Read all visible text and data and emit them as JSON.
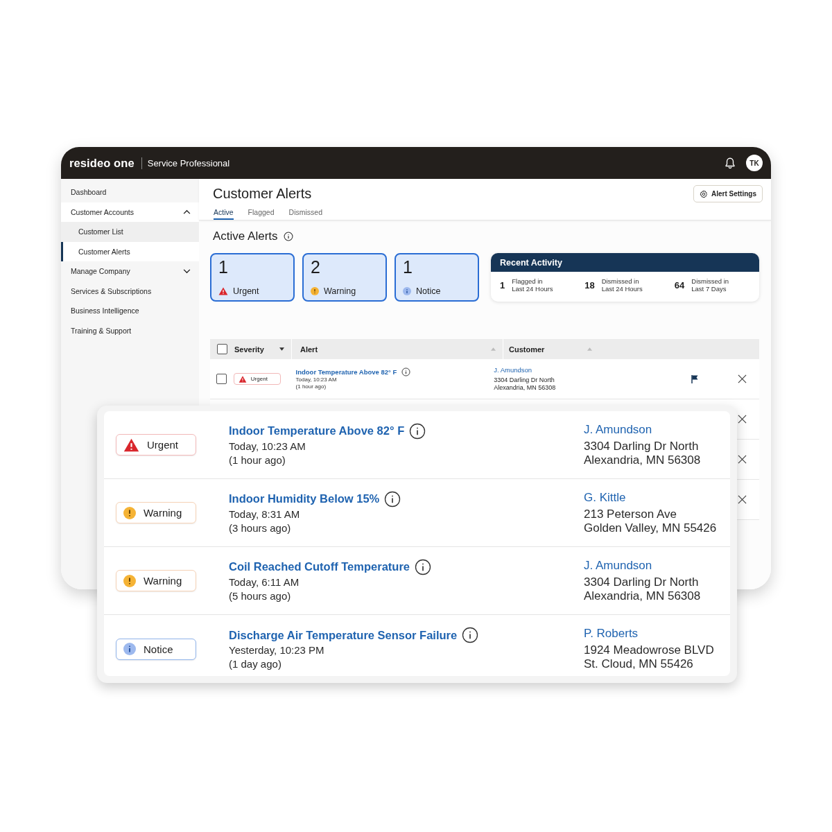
{
  "app": {
    "brand": "resideo one",
    "product": "Service Professional",
    "avatar": "TK"
  },
  "sidebar": {
    "items": [
      {
        "label": "Dashboard",
        "selected": false
      },
      {
        "label": "Customer Accounts",
        "selected": false,
        "expanded": true,
        "children": [
          {
            "label": "Customer List",
            "selected": false
          },
          {
            "label": "Customer Alerts",
            "selected": true
          }
        ]
      },
      {
        "label": "Manage Company",
        "selected": false,
        "expanded": false
      },
      {
        "label": "Services & Subscriptions",
        "selected": false
      },
      {
        "label": "Business Intelligence",
        "selected": false
      },
      {
        "label": "Training & Support",
        "selected": false
      }
    ]
  },
  "page": {
    "title": "Customer Alerts",
    "settings_button": "Alert Settings",
    "tabs": [
      {
        "label": "Active",
        "selected": true
      },
      {
        "label": "Flagged",
        "selected": false
      },
      {
        "label": "Dismissed",
        "selected": false
      }
    ],
    "section_title": "Active Alerts",
    "summary_cards": [
      {
        "count": "1",
        "label": "Urgent",
        "kind": "urgent"
      },
      {
        "count": "2",
        "label": "Warning",
        "kind": "warning"
      },
      {
        "count": "1",
        "label": "Notice",
        "kind": "notice"
      }
    ],
    "recent_activity": {
      "title": "Recent Activity",
      "stats": [
        {
          "count": "1",
          "lines": [
            "Flagged in",
            "Last 24 Hours"
          ]
        },
        {
          "count": "18",
          "lines": [
            "Dismissed in",
            "Last 24 Hours"
          ]
        },
        {
          "count": "64",
          "lines": [
            "Dismissed in",
            "Last 7 Days"
          ]
        }
      ]
    }
  },
  "table": {
    "select_all_checked": false,
    "columns": [
      {
        "label": "Severity",
        "sorted": true
      },
      {
        "label": "Alert",
        "sorted": false
      },
      {
        "label": "Customer",
        "sorted": false
      }
    ],
    "rows": [
      {
        "kind": "full",
        "checked": false,
        "severity": {
          "kind": "urgent",
          "label": "Urgent"
        },
        "alert": "Indoor Temperature Above 82° F",
        "time": "Today, 10:23 AM",
        "ago": "(1 hour ago)",
        "customer": "J. Amundson",
        "address": [
          "3304 Darling Dr North",
          "Alexandria, MN 56308"
        ],
        "flagged": true
      },
      {
        "kind": "covered"
      },
      {
        "kind": "covered"
      },
      {
        "kind": "covered"
      }
    ]
  },
  "detail_rows": [
    {
      "severity": {
        "kind": "urgent",
        "label": "Urgent"
      },
      "alert": "Indoor Temperature Above 82° F",
      "time": "Today, 10:23 AM",
      "ago": "(1 hour ago)",
      "customer": "J. Amundson",
      "address": [
        "3304 Darling Dr North",
        "Alexandria, MN 56308"
      ]
    },
    {
      "severity": {
        "kind": "warning",
        "label": "Warning"
      },
      "alert": "Indoor Humidity Below 15%",
      "time": "Today, 8:31 AM",
      "ago": "(3 hours ago)",
      "customer": "G. Kittle",
      "address": [
        "213 Peterson Ave",
        "Golden Valley, MN 55426"
      ]
    },
    {
      "severity": {
        "kind": "warning",
        "label": "Warning"
      },
      "alert": "Coil Reached Cutoff Temperature",
      "time": "Today, 6:11 AM",
      "ago": "(5 hours ago)",
      "customer": "J. Amundson",
      "address": [
        "3304 Darling Dr North",
        "Alexandria, MN 56308"
      ]
    },
    {
      "severity": {
        "kind": "notice",
        "label": "Notice"
      },
      "alert": "Discharge Air Temperature Sensor Failure",
      "time": "Yesterday, 10:23 PM",
      "ago": "(1 day ago)",
      "customer": "P. Roberts",
      "address": [
        "1924 Meadowrose BLVD",
        "St. Cloud, MN 55426"
      ]
    }
  ]
}
